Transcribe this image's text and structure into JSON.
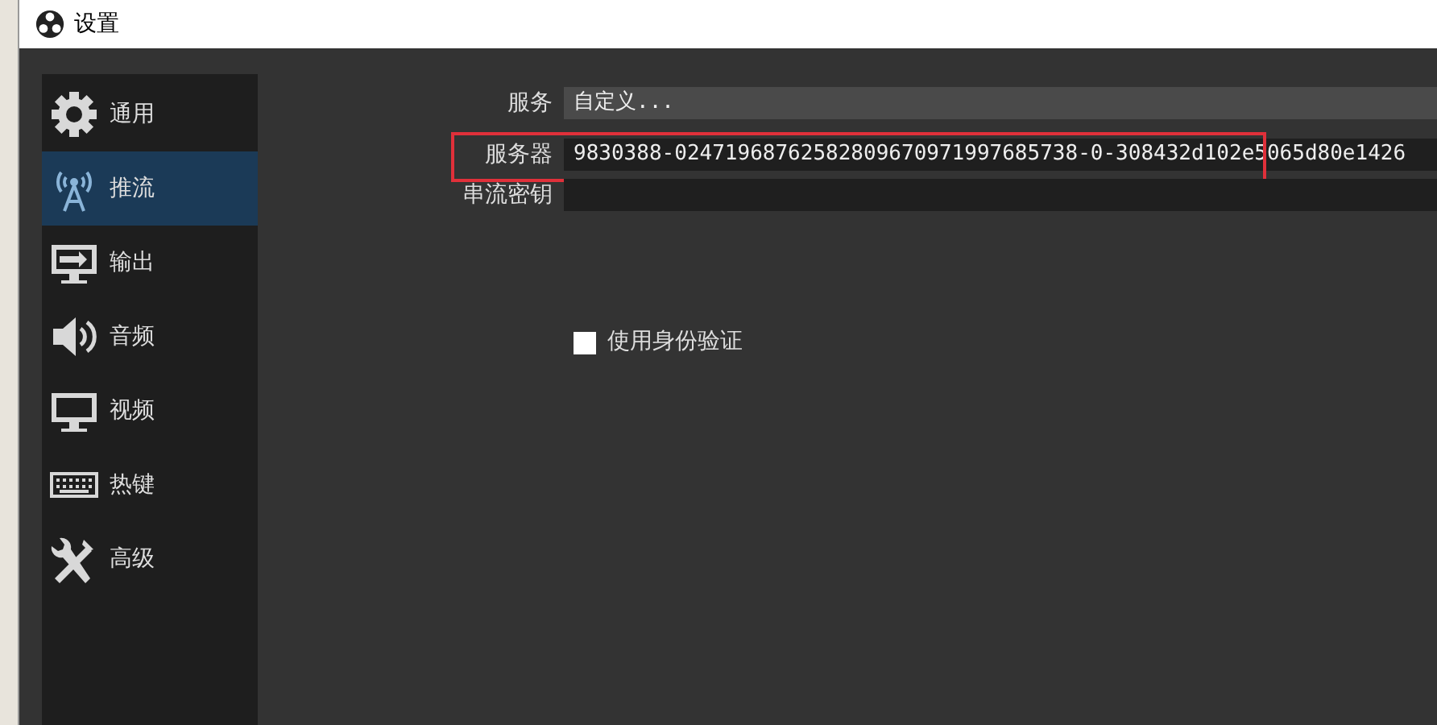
{
  "window": {
    "title": "设置"
  },
  "sidebar": {
    "items": [
      {
        "label": "通用",
        "selected": false
      },
      {
        "label": "推流",
        "selected": true
      },
      {
        "label": "输出",
        "selected": false
      },
      {
        "label": "音频",
        "selected": false
      },
      {
        "label": "视频",
        "selected": false
      },
      {
        "label": "热键",
        "selected": false
      },
      {
        "label": "高级",
        "selected": false
      }
    ]
  },
  "form": {
    "rows": [
      {
        "label": "服务",
        "kind": "select",
        "value": "自定义...",
        "highlighted": false
      },
      {
        "label": "服务器",
        "kind": "text",
        "value": "9830388-02471968762582809670971997685738-0-308432d102e5065d80e1426",
        "highlighted": true
      },
      {
        "label": "串流密钥",
        "kind": "text",
        "value": "",
        "highlighted": false
      }
    ],
    "checkbox": {
      "label": "使用身份验证",
      "checked": false
    }
  }
}
